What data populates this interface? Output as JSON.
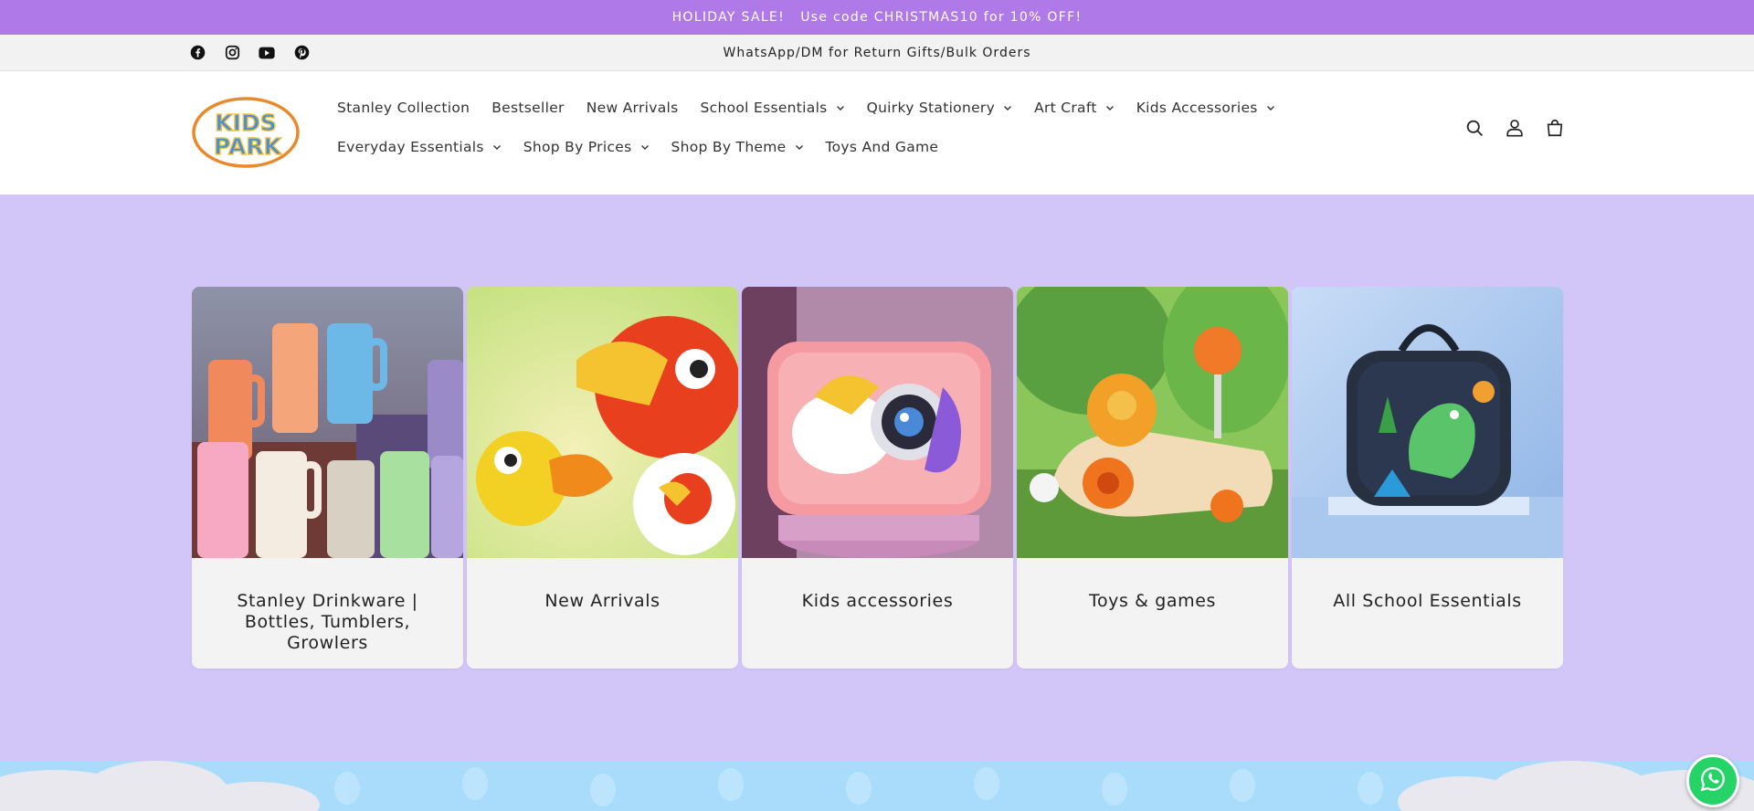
{
  "announcement": {
    "text": "HOLIDAY SALE!   Use code CHRISTMAS10 for 10% OFF!"
  },
  "subbar": {
    "text": "WhatsApp/DM for Return Gifts/Bulk Orders",
    "social": [
      "facebook-icon",
      "instagram-icon",
      "youtube-icon",
      "pinterest-icon"
    ]
  },
  "header": {
    "logo_text": [
      "KIDS",
      "PARK"
    ],
    "nav": [
      {
        "label": "Stanley Collection",
        "dropdown": false
      },
      {
        "label": "Bestseller",
        "dropdown": false
      },
      {
        "label": "New Arrivals",
        "dropdown": false
      },
      {
        "label": "School Essentials",
        "dropdown": true
      },
      {
        "label": "Quirky Stationery",
        "dropdown": true
      },
      {
        "label": "Art Craft",
        "dropdown": true
      },
      {
        "label": "Kids Accessories",
        "dropdown": true
      },
      {
        "label": "Everyday Essentials",
        "dropdown": true
      },
      {
        "label": "Shop By Prices",
        "dropdown": true
      },
      {
        "label": "Shop By Theme",
        "dropdown": true
      },
      {
        "label": "Toys And Game",
        "dropdown": false
      }
    ],
    "icons": [
      "search-icon",
      "account-icon",
      "cart-icon"
    ]
  },
  "collections": [
    {
      "title": "Stanley Drinkware | Bottles, Tumblers, Growlers"
    },
    {
      "title": "New Arrivals"
    },
    {
      "title": "Kids accessories"
    },
    {
      "title": "Toys & games"
    },
    {
      "title": "All School Essentials"
    }
  ],
  "colors": {
    "announcement_bg": "#b079e8",
    "hero_bg": "#d2c5f7",
    "whatsapp": "#25d366"
  }
}
